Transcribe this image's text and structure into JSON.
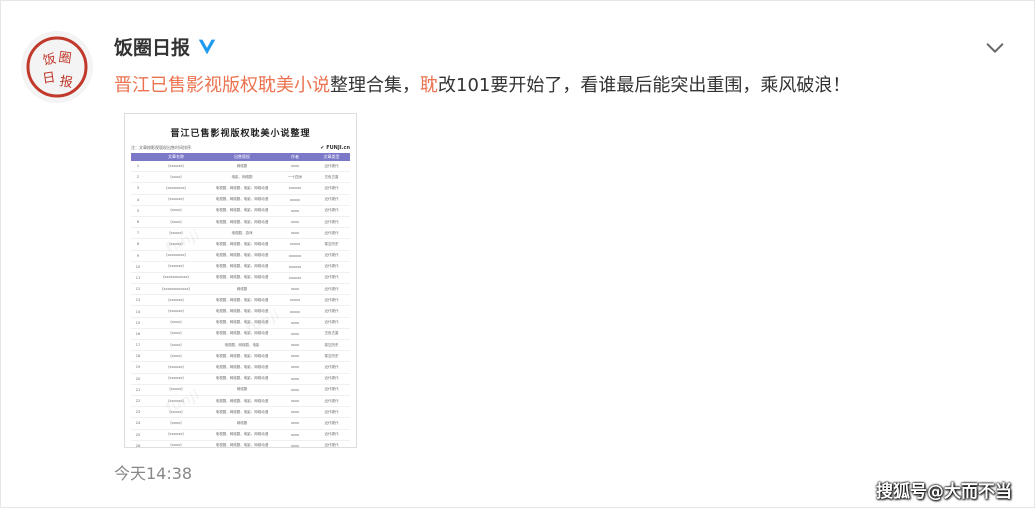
{
  "post": {
    "author": "饭圈日报",
    "avatar_text": "饭圈日报",
    "text_tag": "晋江已售影视版权耽美小说",
    "text_mid": "整理合集，",
    "text_tag2": "耽",
    "text_rest": "改101要开始了，看谁最后能突出重围，乘风破浪！",
    "time": "今天14:38"
  },
  "image": {
    "title": "晋江已售影视版权耽美小说整理",
    "note": "注：文章按影视版权出售时间排序",
    "brand": "✔ FUNJI.cn",
    "columns": [
      "文章名称",
      "出售版权",
      "作者",
      "文章类型"
    ],
    "rows": [
      [
        "1",
        "《xxxxxx》",
        "网络剧",
        "xxxx",
        "近代现代"
      ],
      [
        "2",
        "《xxxx》",
        "电影、网络剧",
        "一十四洲",
        "古色古香"
      ],
      [
        "3",
        "《xxxxxxxx》",
        "电视剧、网络剧、电影、网络动漫",
        "xxxxxx",
        "近代现代"
      ],
      [
        "4",
        "《xxxxxx》",
        "电视剧、网络剧、电影、网络动漫",
        "xxxxx",
        "近代现代"
      ],
      [
        "5",
        "《xxxx》",
        "电视剧、网络剧、电影、网络动漫",
        "xxxx",
        "近代现代"
      ],
      [
        "6",
        "《xxxx》",
        "电视剧、网络剧、电影、网络动漫",
        "xxxx",
        "近代现代"
      ],
      [
        "7",
        "《xxxxx》",
        "电视剧、游戏",
        "xxxx",
        "近代现代"
      ],
      [
        "8",
        "《xxxxx》",
        "电视剧、网络剧、电影、网络动漫",
        "xxxxx",
        "架空历史"
      ],
      [
        "9",
        "《xxxxxxxx》",
        "电视剧、网络剧、电影、网络动漫",
        "xxxxxx",
        "近代现代"
      ],
      [
        "10",
        "《xxxxxx》",
        "电视剧、网络剧、电影、网络动漫",
        "xxxxxx",
        "近代现代"
      ],
      [
        "11",
        "《xxxxxxxxxxx》",
        "电视剧、网络剧、电影、网络动漫",
        "xxxxxx",
        "近代现代"
      ],
      [
        "12",
        "《xxxxxxxxxxxx》",
        "网络剧",
        "xxxx",
        "近代现代"
      ],
      [
        "13",
        "《xxxxxx》",
        "电视剧、网络剧、电影、网络动漫",
        "xxxxx",
        "近代现代"
      ],
      [
        "14",
        "《xxxxxx》",
        "电视剧、网络剧、电影、网络动漫",
        "xxxxx",
        "近代现代"
      ],
      [
        "15",
        "《xxxx》",
        "电视剧、网络剧、电影、网络动漫",
        "xxxx",
        "近代现代"
      ],
      [
        "16",
        "《xxxx》",
        "电视剧、网络剧、电影、网络动漫",
        "xxxx",
        "古色古香"
      ],
      [
        "17",
        "《xxxx》",
        "电视剧、网络剧、电影",
        "xxxx",
        "架空历史"
      ],
      [
        "18",
        "《xxxx》",
        "电视剧、网络剧、电影、网络动漫",
        "xxxx",
        "架空历史"
      ],
      [
        "19",
        "《xxxxxx》",
        "电视剧、网络剧、电影、网络动漫",
        "xxxx",
        "近代现代"
      ],
      [
        "20",
        "《xxxxxx》",
        "电视剧、网络剧、电影、网络动漫",
        "xxxx",
        "近代现代"
      ],
      [
        "21",
        "《xxxxx》",
        "网络剧",
        "xxxx",
        "近代现代"
      ],
      [
        "22",
        "《xxxxxx》",
        "电视剧、网络剧、电影、网络动漫",
        "xxxx",
        "近代现代"
      ],
      [
        "23",
        "《xxxxx》",
        "电视剧、网络剧、电影、网络动漫",
        "xxxx",
        "近代现代"
      ],
      [
        "24",
        "《xxxx》",
        "网络剧",
        "xxxx",
        "近代现代"
      ],
      [
        "25",
        "《xxxxxx》",
        "电视剧、网络剧、电影、网络动漫",
        "xxxx",
        "近代现代"
      ],
      [
        "26",
        "《xxxx》",
        "电视剧、网络剧、电影、网络动漫",
        "xxxx",
        "近代现代"
      ]
    ]
  },
  "credit": "搜狐号@大而不当",
  "icons": {
    "verified": "verified-icon",
    "menu": "chevron-down-icon"
  },
  "colors": {
    "accent": "#eb7350",
    "verified": "#1e9bf0",
    "header": "#7b78c8"
  }
}
